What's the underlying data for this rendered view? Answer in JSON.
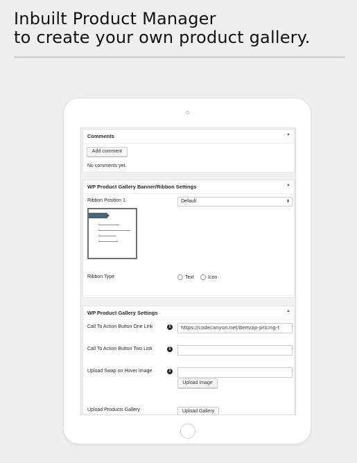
{
  "headline": {
    "line1": "Inbuilt Product Manager",
    "line2": "to create your own product gallery."
  },
  "comments_box": {
    "title": "Comments",
    "toggle_icon": "triangle-up-icon",
    "add_button": "Add comment",
    "empty_text": "No comments yet."
  },
  "ribbon_box": {
    "title": "WP Product Gallery Banner/Ribbon Settings",
    "toggle_icon": "triangle-up-icon",
    "position_label": "Ribbon Position 1",
    "position_value": "Default",
    "type_label": "Ribbon Type",
    "type_options": [
      "Text",
      "Icon"
    ]
  },
  "settings_box": {
    "title": "WP Product Gallery Settings",
    "toggle_icon": "triangle-up-icon",
    "cta1_label": "Call To Action Button One Link",
    "cta1_value": "https://codecanyon.net/item/ap-pricing-t",
    "cta2_label": "Call To Action Button Two Link",
    "cta2_value": "",
    "swap_label": "Upload Swap on Hover Image",
    "swap_value": "",
    "upload_image_button": "Upload Image",
    "gallery_label": "Upload Products Gallery",
    "upload_gallery_button": "Upload Gallery",
    "info_icon": "i"
  },
  "colors": {
    "ribbon": "#4e6275",
    "background": "#efefef"
  }
}
